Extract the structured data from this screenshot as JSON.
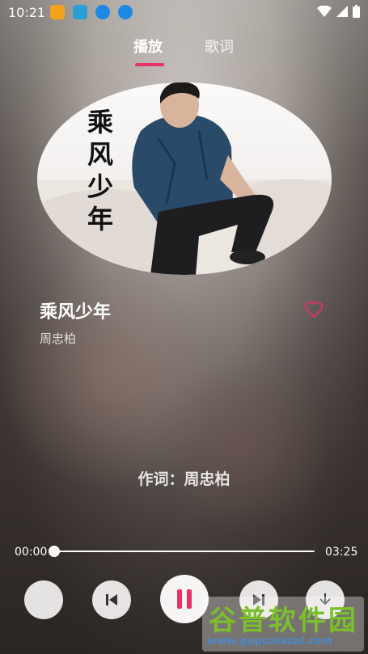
{
  "status_bar": {
    "time": "10:21",
    "notif_colors": [
      "#f3a21b",
      "#2a9fd6",
      "#1e88e5",
      "#1e88e5"
    ]
  },
  "tabs": [
    {
      "label": "播放",
      "active": true
    },
    {
      "label": "歌词",
      "active": false
    }
  ],
  "cover": {
    "calligraphy": [
      "乘",
      "风",
      "少",
      "年"
    ]
  },
  "song": {
    "title": "乘风少年",
    "artist": "周忠柏",
    "favorited": false
  },
  "lyrics": {
    "current": "作词：周忠柏"
  },
  "player": {
    "elapsed": "00:00",
    "duration": "03:25",
    "progress_fraction": 0.0,
    "state": "playing"
  },
  "controls": [
    "mode-button",
    "previous-button",
    "pause-button",
    "next-button",
    "download-button"
  ],
  "watermark": {
    "brand": "谷普软件园",
    "url": "www.gupuxlazal.com"
  },
  "colors": {
    "accent": "#e8326a"
  }
}
